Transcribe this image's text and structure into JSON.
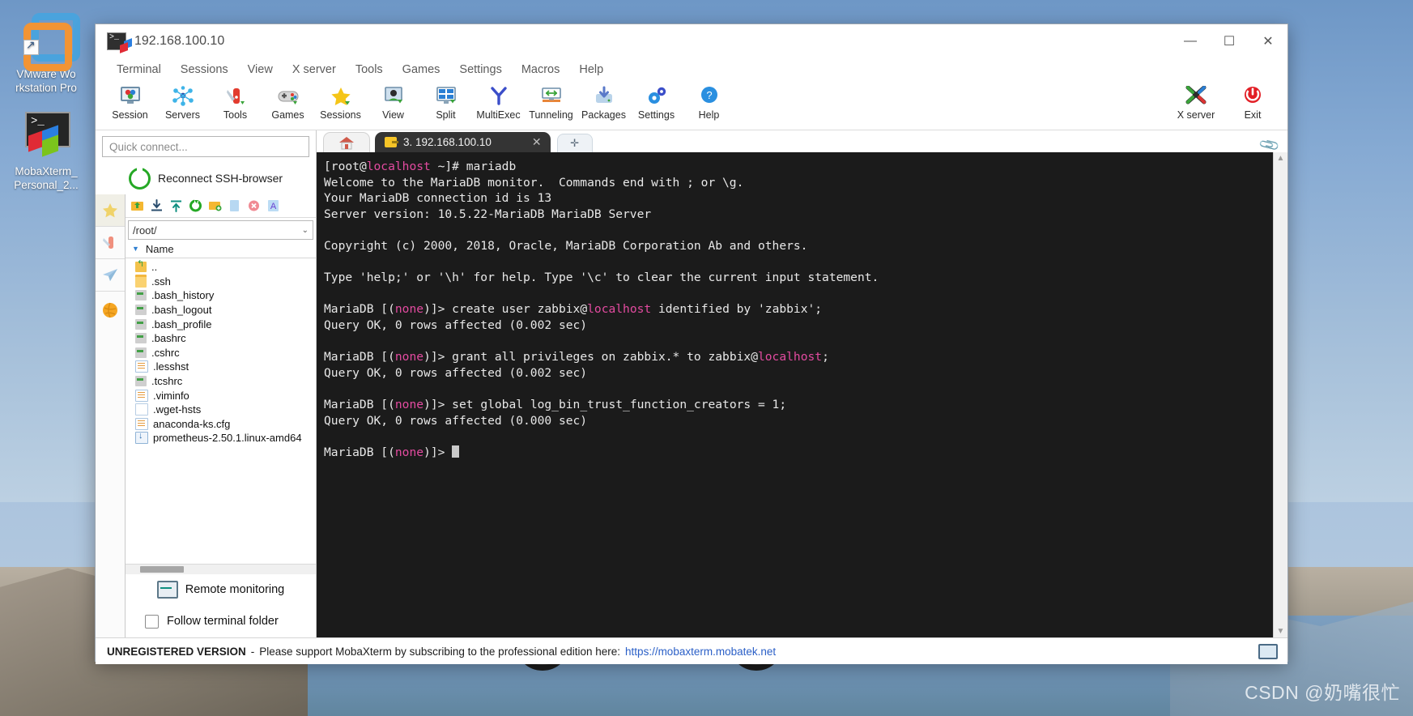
{
  "desktop": {
    "icons": [
      {
        "name": "vmware-workstation-pro",
        "label": "VMware Wo rkstation Pro"
      },
      {
        "name": "mobaxterm",
        "label": "MobaXterm_ Personal_2..."
      }
    ],
    "watermark": "CSDN @奶嘴很忙"
  },
  "window": {
    "title": "192.168.100.10",
    "controls": {
      "minimize": "—",
      "maximize": "☐",
      "close": "✕"
    },
    "menu": [
      "Terminal",
      "Sessions",
      "View",
      "X server",
      "Tools",
      "Games",
      "Settings",
      "Macros",
      "Help"
    ],
    "toolbar": [
      {
        "icon": "session-icon",
        "label": "Session"
      },
      {
        "icon": "servers-icon",
        "label": "Servers"
      },
      {
        "icon": "tools-icon",
        "label": "Tools"
      },
      {
        "icon": "games-icon",
        "label": "Games"
      },
      {
        "icon": "sessions-star-icon",
        "label": "Sessions"
      },
      {
        "icon": "view-icon",
        "label": "View"
      },
      {
        "icon": "split-icon",
        "label": "Split"
      },
      {
        "icon": "multiexec-icon",
        "label": "MultiExec"
      },
      {
        "icon": "tunneling-icon",
        "label": "Tunneling"
      },
      {
        "icon": "packages-icon",
        "label": "Packages"
      },
      {
        "icon": "settings-gear-icon",
        "label": "Settings"
      },
      {
        "icon": "help-icon",
        "label": "Help"
      }
    ],
    "toolbar_right": [
      {
        "icon": "x-server-icon",
        "label": "X server"
      },
      {
        "icon": "exit-power-icon",
        "label": "Exit"
      }
    ]
  },
  "sidebar": {
    "quick_connect_placeholder": "Quick connect...",
    "reconnect_label": "Reconnect SSH-browser",
    "vtabs": [
      {
        "name": "bookmarks-tab",
        "glyph": "★"
      },
      {
        "name": "tools-tab",
        "glyph": "🔧"
      },
      {
        "name": "sftp-tab",
        "glyph": "➤"
      },
      {
        "name": "globe-tab",
        "glyph": "🌐"
      }
    ],
    "sftp_tools": [
      "up-folder-icon",
      "download-icon",
      "upload-icon",
      "refresh-icon",
      "new-folder-icon",
      "new-file-icon",
      "delete-icon",
      "text-mode-icon"
    ],
    "path": "/root/",
    "column_header": "Name",
    "files": [
      {
        "name": "..",
        "type": "up"
      },
      {
        "name": ".ssh",
        "type": "folder"
      },
      {
        "name": ".bash_history",
        "type": "script"
      },
      {
        "name": ".bash_logout",
        "type": "script"
      },
      {
        "name": ".bash_profile",
        "type": "script"
      },
      {
        "name": ".bashrc",
        "type": "script"
      },
      {
        "name": ".cshrc",
        "type": "script"
      },
      {
        "name": ".lesshst",
        "type": "doc"
      },
      {
        "name": ".tcshrc",
        "type": "script"
      },
      {
        "name": ".viminfo",
        "type": "doc"
      },
      {
        "name": ".wget-hsts",
        "type": "plain"
      },
      {
        "name": "anaconda-ks.cfg",
        "type": "doc"
      },
      {
        "name": "prometheus-2.50.1.linux-amd64",
        "type": "arch"
      }
    ],
    "remote_monitoring": "Remote monitoring",
    "follow_terminal_folder": "Follow terminal folder"
  },
  "tabs": {
    "home_tab": "home-icon",
    "terminal_tab": "3. 192.168.100.10",
    "close_glyph": "✕",
    "new_tab_glyph": "✛"
  },
  "terminal": {
    "prompt_user": "root",
    "prompt_host": "localhost",
    "lines": [
      [
        {
          "t": "[",
          "c": "w"
        },
        {
          "t": "root@",
          "c": "w"
        },
        {
          "t": "localhost",
          "c": "m"
        },
        {
          "t": " ~]# mariadb",
          "c": "w"
        }
      ],
      [
        {
          "t": "Welcome to the MariaDB monitor.  Commands end with ; or \\g.",
          "c": "w"
        }
      ],
      [
        {
          "t": "Your MariaDB connection id is 13",
          "c": "w"
        }
      ],
      [
        {
          "t": "Server version: 10.5.22-MariaDB MariaDB Server",
          "c": "w"
        }
      ],
      [
        {
          "t": "",
          "c": "w"
        }
      ],
      [
        {
          "t": "Copyright (c) 2000, 2018, Oracle, MariaDB Corporation Ab and others.",
          "c": "w"
        }
      ],
      [
        {
          "t": "",
          "c": "w"
        }
      ],
      [
        {
          "t": "Type 'help;' or '\\h' for help. Type '\\c' to clear the current input statement.",
          "c": "w"
        }
      ],
      [
        {
          "t": "",
          "c": "w"
        }
      ],
      [
        {
          "t": "MariaDB [(",
          "c": "w"
        },
        {
          "t": "none",
          "c": "m"
        },
        {
          "t": ")]> create user zabbix@",
          "c": "w"
        },
        {
          "t": "localhost",
          "c": "m"
        },
        {
          "t": " identified by 'zabbix';",
          "c": "w"
        }
      ],
      [
        {
          "t": "Query OK, 0 rows affected (0.002 sec)",
          "c": "w"
        }
      ],
      [
        {
          "t": "",
          "c": "w"
        }
      ],
      [
        {
          "t": "MariaDB [(",
          "c": "w"
        },
        {
          "t": "none",
          "c": "m"
        },
        {
          "t": ")]> grant all privileges on zabbix.* to zabbix@",
          "c": "w"
        },
        {
          "t": "localhost",
          "c": "m"
        },
        {
          "t": ";",
          "c": "w"
        }
      ],
      [
        {
          "t": "Query OK, 0 rows affected (0.002 sec)",
          "c": "w"
        }
      ],
      [
        {
          "t": "",
          "c": "w"
        }
      ],
      [
        {
          "t": "MariaDB [(",
          "c": "w"
        },
        {
          "t": "none",
          "c": "m"
        },
        {
          "t": ")]> set global log_bin_trust_function_creators = 1;",
          "c": "w"
        }
      ],
      [
        {
          "t": "Query OK, 0 rows affected (0.000 sec)",
          "c": "w"
        }
      ],
      [
        {
          "t": "",
          "c": "w"
        }
      ],
      [
        {
          "t": "MariaDB [(",
          "c": "w"
        },
        {
          "t": "none",
          "c": "m"
        },
        {
          "t": ")]> ",
          "c": "w"
        },
        {
          "t": "CURSOR",
          "c": "cur"
        }
      ]
    ],
    "colors": {
      "background": "#1b1b1b",
      "foreground": "#e6e6e6",
      "magenta": "#e34ba0"
    }
  },
  "statusbar": {
    "unregistered": "UNREGISTERED VERSION",
    "dash": "-",
    "message": "Please support MobaXterm by subscribing to the professional edition here:",
    "link": "https://mobaxterm.mobatek.net"
  }
}
